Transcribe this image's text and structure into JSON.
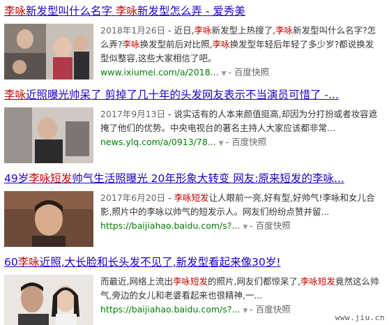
{
  "results": [
    {
      "title_parts": [
        {
          "t": "李咏",
          "hl": true
        },
        {
          "t": "新发型叫什么名字 ",
          "hl": false
        },
        {
          "t": "李咏",
          "hl": true
        },
        {
          "t": "新发型怎么弄 - 爱秀美",
          "hl": false
        }
      ],
      "date": "2018年1月26日",
      "snippet_parts": [
        {
          "t": " - 近日,",
          "hl": false
        },
        {
          "t": "李咏",
          "hl": true
        },
        {
          "t": "新发型上热搜了,",
          "hl": false
        },
        {
          "t": "李咏",
          "hl": true
        },
        {
          "t": "新发型叫什么名字?怎么弄?",
          "hl": false
        },
        {
          "t": "李咏",
          "hl": true
        },
        {
          "t": "换发型前后对比照,",
          "hl": false
        },
        {
          "t": "李咏",
          "hl": true
        },
        {
          "t": "换发型年轻后年轻了多少岁?都说换发型似整容,这些大家相信了吧。",
          "hl": false
        }
      ],
      "url": "www.ixiumei.com/a/2018...",
      "snapshot": "百度快照"
    },
    {
      "title_parts": [
        {
          "t": "李咏",
          "hl": true
        },
        {
          "t": "近照曝光帅呆了 剪掉了几十年的头发网友表示不当演员可惜了 -...",
          "hl": false
        }
      ],
      "date": "2017年9月13日",
      "snippet_parts": [
        {
          "t": " - 说实话有的人本来颜值挺高,却因为分打扮或者妆容遮掩了他们的优势。中央电视台的著名主持人大家应该都非常...",
          "hl": false
        }
      ],
      "url": "news.ylq.com/a/0913/78...",
      "snapshot": "百度快照"
    },
    {
      "title_parts": [
        {
          "t": "49岁",
          "hl": false
        },
        {
          "t": "李咏短发",
          "hl": true
        },
        {
          "t": "帅气生活照曝光 20年形象大转变 网友:原来短发的李咏...",
          "hl": false
        }
      ],
      "date": "2017年6月20日",
      "snippet_parts": [
        {
          "t": " - ",
          "hl": false
        },
        {
          "t": "李咏短发",
          "hl": true
        },
        {
          "t": "让人眼前一亮,好有型,好帅气!李咏和女儿合影,照片中的李咏以帅气的短发示人。网友们纷纷点赞并留...",
          "hl": false
        }
      ],
      "url": "https://baijiahao.baidu.com/s?...",
      "snapshot": "百度快照"
    },
    {
      "title_parts": [
        {
          "t": "60",
          "hl": false
        },
        {
          "t": "李咏",
          "hl": true
        },
        {
          "t": "近照,大长脸和长头发不见了,新发型看起来像30岁!",
          "hl": false
        }
      ],
      "date": "",
      "snippet_parts": [
        {
          "t": "而最近,网络上流出",
          "hl": false
        },
        {
          "t": "李咏短发",
          "hl": true
        },
        {
          "t": "的照片,网友们都惊呆了,",
          "hl": false
        },
        {
          "t": "李咏短发",
          "hl": true
        },
        {
          "t": "竟然这么帅气,旁边的女儿和老婆看起来也很精神,一...",
          "hl": false
        }
      ],
      "url": "https://baijiahao.baidu.com/s?...",
      "snapshot": "百度快照"
    }
  ],
  "watermark": "www.jiu.cn",
  "colors": {
    "title": "#2200cc",
    "highlight": "#cc0000",
    "url": "#008000",
    "text": "#333333"
  }
}
